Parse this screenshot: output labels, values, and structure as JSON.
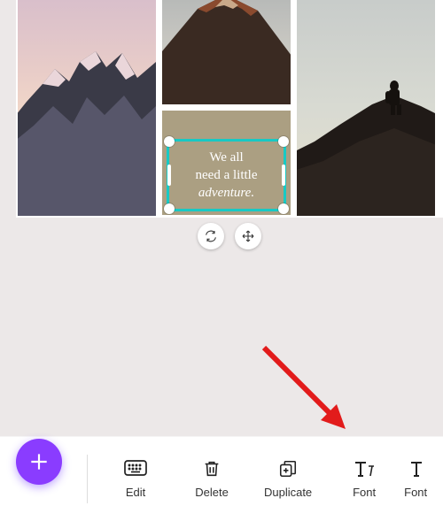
{
  "text_box": {
    "line1": "We all",
    "line2": "need a little",
    "line3": "adventure."
  },
  "toolbar": {
    "edit": "Edit",
    "delete": "Delete",
    "duplicate": "Duplicate",
    "font": "Font",
    "fontsize": "Font"
  }
}
